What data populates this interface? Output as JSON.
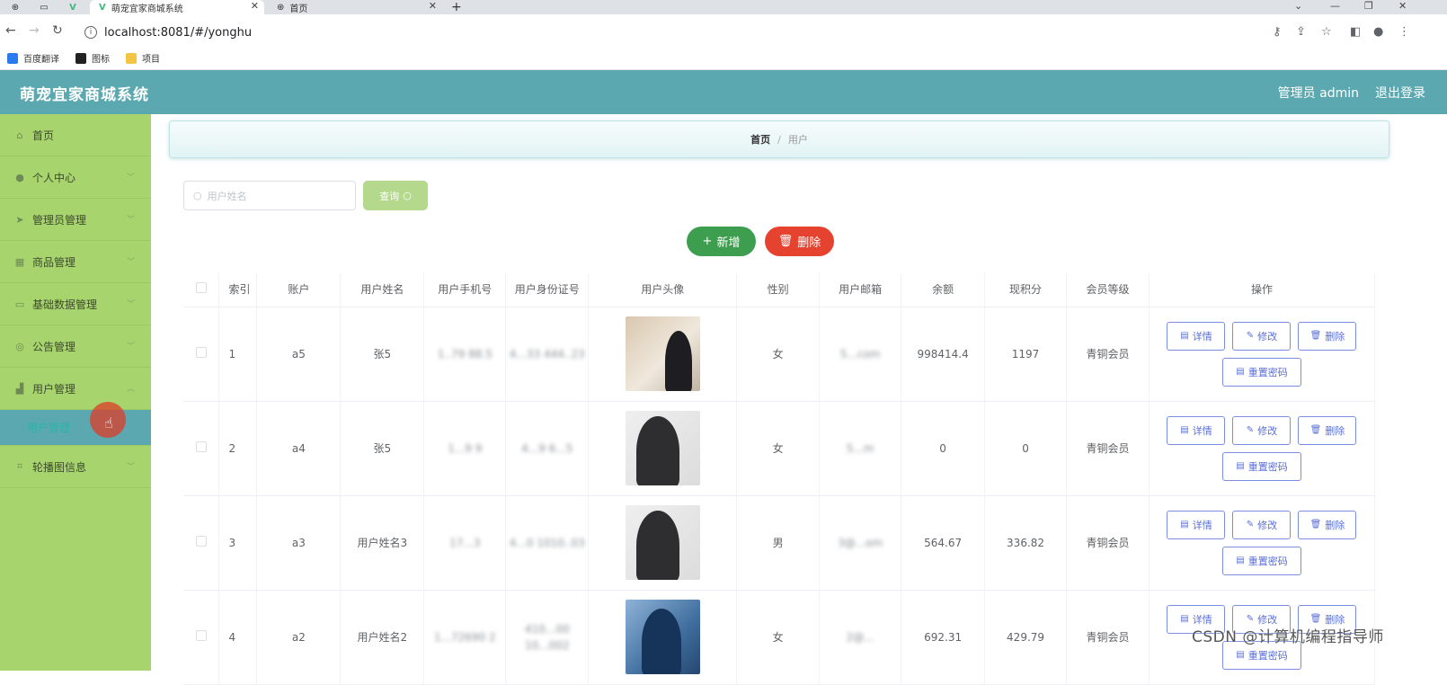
{
  "browser": {
    "tabs": [
      {
        "title": "萌宠宜家商城系统",
        "active": true
      },
      {
        "title": "首页",
        "active": false
      }
    ],
    "url": "localhost:8081/#/yonghu",
    "bookmarks": [
      "百度翻译",
      "图标",
      "项目"
    ]
  },
  "app": {
    "title": "萌宠宜家商城系统",
    "user_label": "管理员 admin",
    "logout": "退出登录"
  },
  "sidebar": {
    "items": [
      {
        "label": "首页",
        "icon": "home-icon"
      },
      {
        "label": "个人中心",
        "icon": "person-icon"
      },
      {
        "label": "管理员管理",
        "icon": "send-icon"
      },
      {
        "label": "商品管理",
        "icon": "grid-icon"
      },
      {
        "label": "基础数据管理",
        "icon": "chart-icon"
      },
      {
        "label": "公告管理",
        "icon": "info-icon"
      },
      {
        "label": "用户管理",
        "icon": "building-icon"
      },
      {
        "label": "轮播图信息",
        "icon": "crop-icon"
      }
    ],
    "sub_item": "用户管理"
  },
  "breadcrumb": {
    "home": "首页",
    "current": "用户"
  },
  "search": {
    "placeholder": "用户姓名",
    "button": "查询"
  },
  "actions": {
    "add": "新增",
    "delete": "删除"
  },
  "table": {
    "headers": [
      "索引",
      "账户",
      "用户姓名",
      "用户手机号",
      "用户身份证号",
      "用户头像",
      "性别",
      "用户邮箱",
      "余额",
      "现积分",
      "会员等级",
      "操作"
    ],
    "rows": [
      {
        "index": "1",
        "account": "a5",
        "name": "张5",
        "phone": "1..79 88.5",
        "idcard": "4...33 444..23",
        "gender": "女",
        "email": "5...com",
        "balance": "998414.4",
        "points": "1197",
        "level": "青铜会员"
      },
      {
        "index": "2",
        "account": "a4",
        "name": "张5",
        "phone": "1...9 9",
        "idcard": "4...9 6...5",
        "gender": "女",
        "email": "5...m",
        "balance": "0",
        "points": "0",
        "level": "青铜会员"
      },
      {
        "index": "3",
        "account": "a3",
        "name": "用户姓名3",
        "phone": "17...3",
        "idcard": "4...0 1010..03",
        "gender": "男",
        "email": "3@...om",
        "balance": "564.67",
        "points": "336.82",
        "level": "青铜会员"
      },
      {
        "index": "4",
        "account": "a2",
        "name": "用户姓名2",
        "phone": "1...72690 2",
        "idcard": "410...00 10...002",
        "gender": "女",
        "email": "2@...",
        "balance": "692.31",
        "points": "429.79",
        "level": "青铜会员"
      }
    ],
    "ops": {
      "detail": "详情",
      "edit": "修改",
      "delete": "删除",
      "reset": "重置密码"
    }
  },
  "watermark": "CSDN @计算机编程指导师"
}
